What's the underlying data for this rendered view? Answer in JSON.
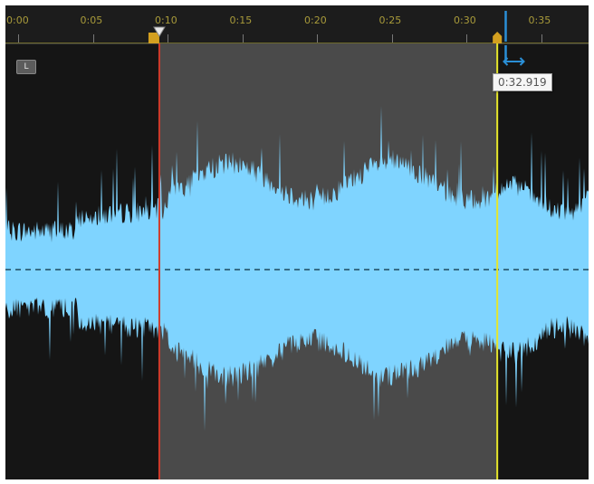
{
  "ruler": {
    "labels": [
      "0:00",
      "0:05",
      "0:10",
      "0:15",
      "0:20",
      "0:25",
      "0:30",
      "0:35"
    ],
    "seconds_per_label": 5
  },
  "selection": {
    "start_seconds": 10.3,
    "end_seconds": 32.919,
    "start_marker_color": "#d03a2a",
    "end_marker_color": "#e6e62a"
  },
  "playhead": {
    "seconds": 33.0,
    "color": "#2a8fd6"
  },
  "channel": {
    "label": "L"
  },
  "cursor_tooltip": {
    "time": "0:32.919"
  },
  "colors": {
    "waveform": "#7fd4ff",
    "background": "#151515",
    "selection_background": "#4a4a4a",
    "ruler_text": "#a89a3a",
    "center_line": "#1f4a5e"
  },
  "icons": {
    "playhead_handle": "triangle-down-icon",
    "move_cursor": "resize-horizontal-cursor-icon"
  }
}
